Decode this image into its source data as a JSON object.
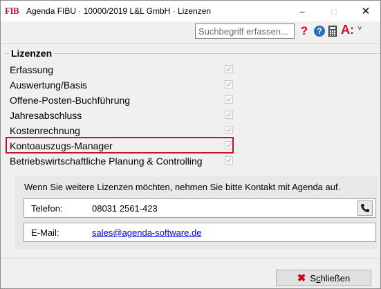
{
  "window": {
    "logo_text": "FIB",
    "title": "Agenda FIBU · 10000/2019 L&L GmbH · Lizenzen",
    "minimize_glyph": "–",
    "maximize_glyph": "□",
    "close_glyph": "✕"
  },
  "toolbar": {
    "search_placeholder": "Suchbegriff erfassen...",
    "help_red": "?",
    "help_blue": "?",
    "menu_a": "A:",
    "menu_chevron": "˅"
  },
  "licenses": {
    "title": "Lizenzen",
    "items": [
      {
        "label": "Erfassung",
        "checked": true
      },
      {
        "label": "Auswertung/Basis",
        "checked": true
      },
      {
        "label": "Offene-Posten-Buchführung",
        "checked": true
      },
      {
        "label": "Jahresabschluss",
        "checked": true
      },
      {
        "label": "Kostenrechnung",
        "checked": true
      },
      {
        "label": "Kontoauszugs-Manager",
        "checked": true
      },
      {
        "label": "Betriebswirtschaftliche Planung & Controlling",
        "checked": true
      }
    ],
    "highlighted_index": 5,
    "highlight_color": "#c8102e"
  },
  "contact": {
    "intro": "Wenn Sie weitere Lizenzen möchten, nehmen Sie bitte Kontakt mit Agenda auf.",
    "phone_label": "Telefon:",
    "phone_value": "08031 2561-423",
    "email_label": "E-Mail:",
    "email_value": "sales@agenda-software.de"
  },
  "footer": {
    "close_label_prefix": "S",
    "close_label_underlined": "c",
    "close_label_rest": "hließen"
  },
  "colors": {
    "accent_red": "#c8102e",
    "help_blue": "#2a6fb5"
  }
}
